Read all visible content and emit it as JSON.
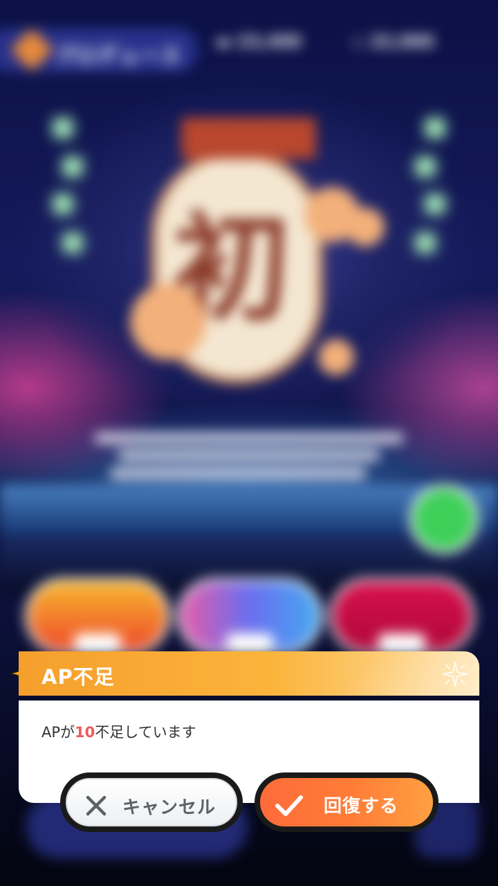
{
  "background": {
    "header_label": "プロデュース",
    "stat_1": "▬ 23,400",
    "stat_2": "◇ 22,000",
    "logo_glyph": "初"
  },
  "dialog": {
    "title": "AP不足",
    "message_prefix": "APが",
    "message_amount": "10",
    "message_suffix": "不足しています",
    "header_color": "#F59F2C",
    "amount_color": "#EF5A5A"
  },
  "buttons": {
    "cancel_label": "キャンセル",
    "cancel_icon": "close-icon",
    "confirm_label": "回復する",
    "confirm_icon": "check-icon",
    "confirm_color": "#FF6B3B"
  }
}
